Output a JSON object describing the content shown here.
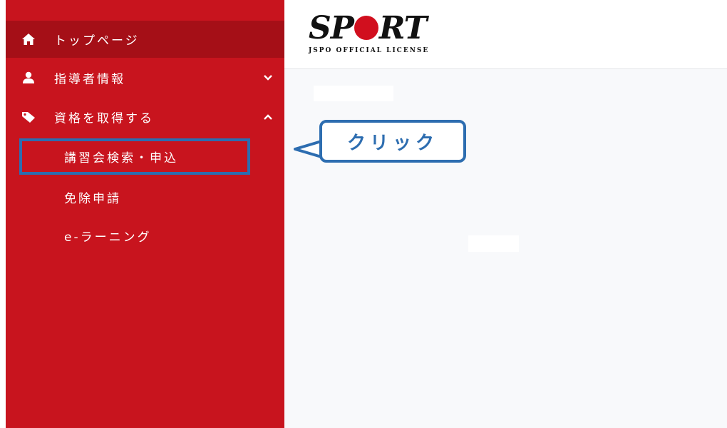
{
  "sidebar": {
    "items": [
      {
        "label": "トップページ",
        "icon": "home-icon"
      },
      {
        "label": "指導者情報",
        "icon": "user-icon",
        "expanded": false
      },
      {
        "label": "資格を取得する",
        "icon": "tag-icon",
        "expanded": true
      }
    ],
    "sub_items": [
      {
        "label": "講習会検索・申込"
      },
      {
        "label": "免除申請"
      },
      {
        "label": "e-ラーニング"
      }
    ]
  },
  "header": {
    "logo_main_a": "SP",
    "logo_main_b": "RT",
    "logo_sub": "JSPO OFFICIAL LICENSE"
  },
  "annotation": {
    "callout_text": "クリック"
  },
  "colors": {
    "sidebar_bg": "#c8141e",
    "active_bg": "#a50f17",
    "highlight": "#2d6db0",
    "logo_dot": "#d10f1e"
  }
}
